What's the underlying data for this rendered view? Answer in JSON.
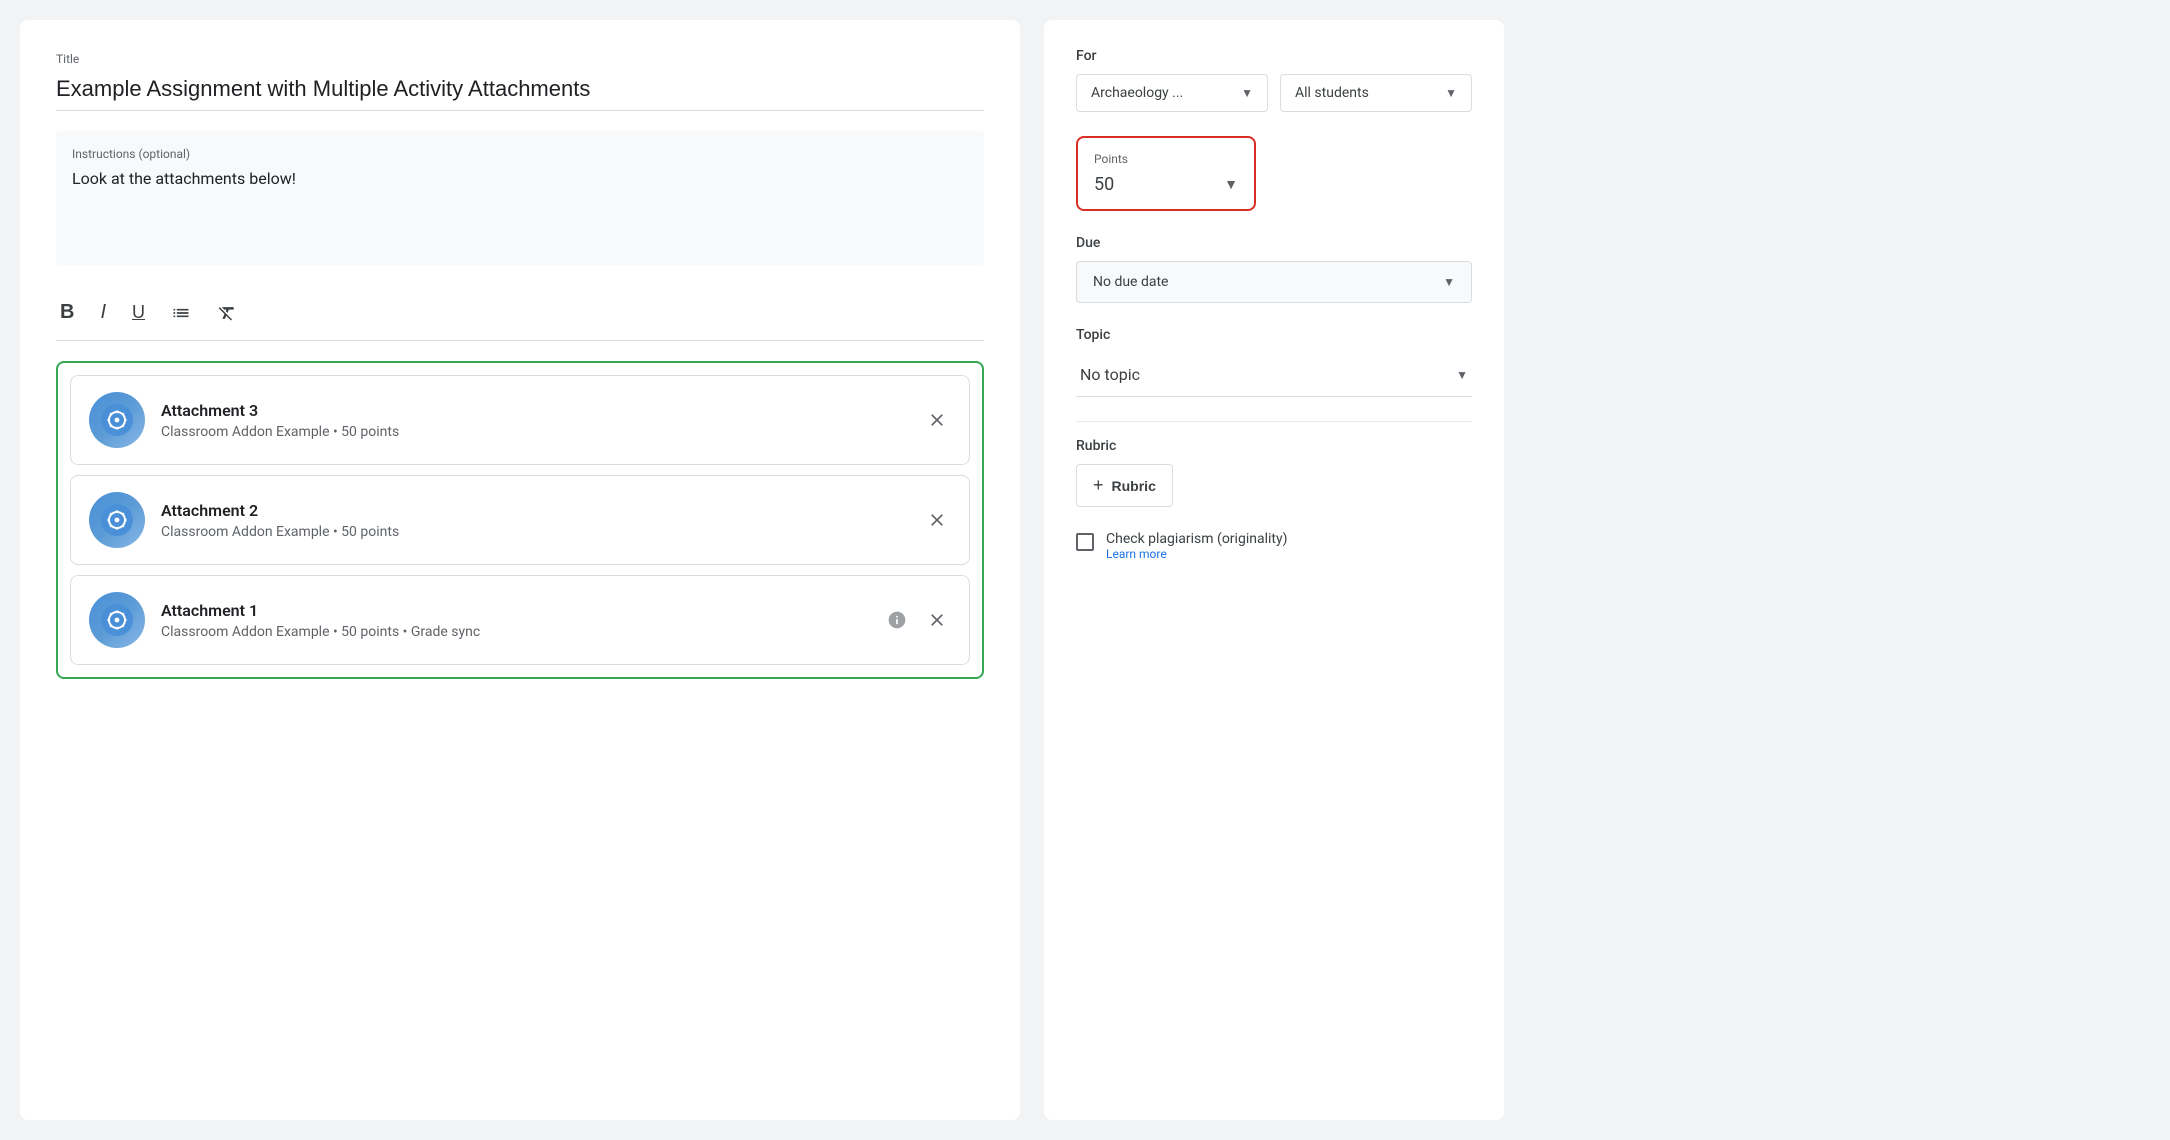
{
  "main": {
    "title_label": "Title",
    "title_value": "Example Assignment with Multiple Activity Attachments",
    "instructions_label": "Instructions (optional)",
    "instructions_value": "Look at the attachments below!",
    "toolbar": {
      "bold": "B",
      "italic": "I",
      "underline": "U"
    },
    "attachments": [
      {
        "id": 3,
        "title": "Attachment 3",
        "meta": "Classroom Addon Example • 50 points",
        "show_info": false
      },
      {
        "id": 2,
        "title": "Attachment 2",
        "meta": "Classroom Addon Example • 50 points",
        "show_info": false
      },
      {
        "id": 1,
        "title": "Attachment 1",
        "meta": "Classroom Addon Example • 50 points • Grade sync",
        "show_info": true
      }
    ]
  },
  "sidebar": {
    "for_label": "For",
    "class_value": "Archaeology ...",
    "students_value": "All students",
    "points_label": "Points",
    "points_value": "50",
    "due_label": "Due",
    "due_value": "No due date",
    "topic_label": "Topic",
    "topic_value": "No topic",
    "rubric_label": "Rubric",
    "rubric_btn_label": "Rubric",
    "plagiarism_label": "Check plagiarism (originality)",
    "plagiarism_link": "Learn more"
  }
}
